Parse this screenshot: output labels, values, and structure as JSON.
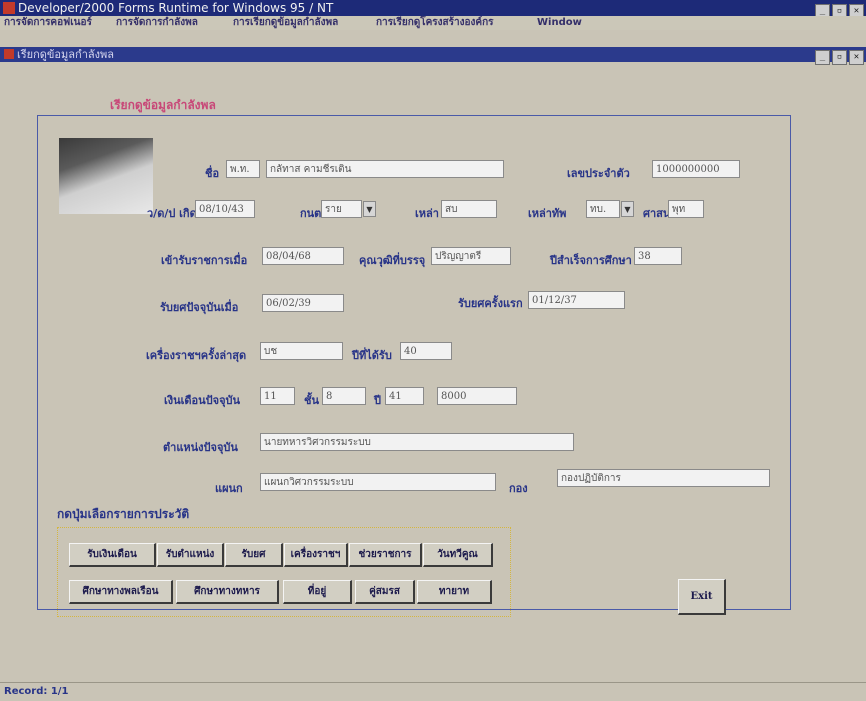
{
  "window": {
    "title": "Developer/2000 Forms Runtime for Windows 95 / NT",
    "buttons": [
      "_",
      "▫",
      "✕"
    ]
  },
  "menu": [
    "การจัดการคอฟเนอร์",
    "การจัดการกำลังพล",
    "การเรียกดูข้อมูลกำลังพล",
    "การเรียกดูโครงสร้างองค์กร",
    "Window"
  ],
  "form": {
    "title": "เรียกดูข้อมูลกำลังพล",
    "buttons": [
      "_",
      "▫",
      "✕"
    ],
    "section_title": "เรียกดูข้อมูลกำลังพล"
  },
  "fields": {
    "name": {
      "label": "ชื่อ",
      "prefix": "พ.ท.",
      "value": "กลัทาส คามชีรเติน"
    },
    "id_card": {
      "label": "เลขประจำตัว",
      "value": "1000000000"
    },
    "birth": {
      "label": "ว/ด/ป เกิด",
      "value": "08/10/43"
    },
    "blood": {
      "label": "กนต",
      "value": "ราย"
    },
    "corps": {
      "label": "เหล่า",
      "value": "สบ"
    },
    "branch_code": {
      "label": "เหล่าทัพ",
      "value": "ทบ."
    },
    "religion": {
      "label": "ศาสนา",
      "value": "พุท"
    },
    "gov_start": {
      "label": "เข้ารับราชการเมื่อ",
      "value": "08/04/68"
    },
    "degree": {
      "label": "คุณวุฒิที่บรรจุ",
      "value": "ปริญญาตรี"
    },
    "grad_year": {
      "label": "ปีสำเร็จการศึกษา",
      "value": "38"
    },
    "current_rank_date": {
      "label": "รับยศปัจจุบันเมื่อ",
      "value": "06/02/39"
    },
    "first_rank": {
      "label": "รับยศครั้งแรก",
      "value": "01/12/37"
    },
    "latest_decoration": {
      "label": "เครื่องราชฯครั้งล่าสุด",
      "value": "บช"
    },
    "decoration_year": {
      "label": "ปีที่ได้รับ",
      "value": "40"
    },
    "salary": {
      "label": "เงินเดือนปัจจุบัน",
      "level": "11",
      "step_label": "ชั้น",
      "step": "8",
      "year_label": "ปี",
      "year": "41",
      "amount": "8000"
    },
    "position": {
      "label": "ตำแหน่งปัจจุบัน",
      "value": "นายทหารวิศวกรรมระบบ"
    },
    "department": {
      "label": "แผนก",
      "value": "แผนกวิศวกรรมระบบ"
    },
    "division": {
      "label": "กอง",
      "value": "กองปฏิบัติการ"
    }
  },
  "history_section": {
    "title": "กดปุ่มเลือกรายการประวัติ",
    "row1": [
      "รับเงินเดือน",
      "รับตำแหน่ง",
      "รับยศ",
      "เครื่องราชฯ",
      "ช่วยราชการ",
      "วันทวีคูณ"
    ],
    "row2": [
      "ศึกษาทางพลเรือน",
      "ศึกษาทางทหาร",
      "ที่อยู่",
      "คู่สมรส",
      "ทายาท"
    ]
  },
  "exit_label": "Exit",
  "status": "Record: 1/1"
}
